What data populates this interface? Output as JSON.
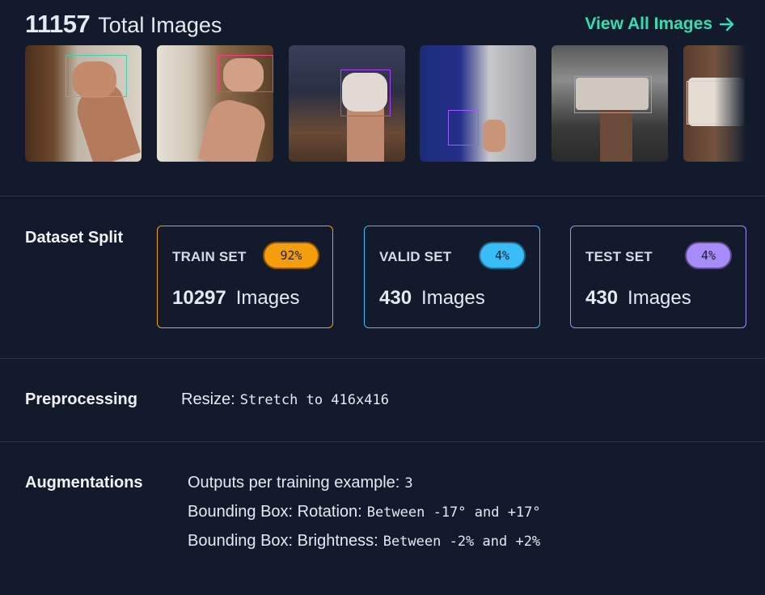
{
  "header": {
    "total_count": "11157",
    "total_label": "Total Images",
    "view_all_label": "View All Images"
  },
  "thumbnails": [
    {
      "icon": "hand-photo",
      "bbox_color": "#3fd0a8"
    },
    {
      "icon": "hand-photo",
      "bbox_color": "#ff3b7a"
    },
    {
      "icon": "hand-photo",
      "bbox_color": "#b23cff"
    },
    {
      "icon": "hand-photo",
      "bbox_color": "#9b5cff"
    },
    {
      "icon": "hand-photo",
      "bbox_color": "#9aa0aa"
    },
    {
      "icon": "hand-photo",
      "bbox_color": "#d0d0d0"
    }
  ],
  "dataset_split": {
    "label": "Dataset Split",
    "cards": [
      {
        "name": "TRAIN SET",
        "percent": "92%",
        "count": "10297",
        "unit": "Images",
        "color": "#f59e0b"
      },
      {
        "name": "VALID SET",
        "percent": "4%",
        "count": "430",
        "unit": "Images",
        "color": "#38bdf8"
      },
      {
        "name": "TEST SET",
        "percent": "4%",
        "count": "430",
        "unit": "Images",
        "color": "#a78bfa"
      }
    ]
  },
  "preprocessing": {
    "label": "Preprocessing",
    "key": "Resize:",
    "value": "Stretch to 416x416"
  },
  "augmentations": {
    "label": "Augmentations",
    "items": [
      {
        "key": "Outputs per training example:",
        "value": "3"
      },
      {
        "key": "Bounding Box: Rotation:",
        "value": "Between -17° and +17°"
      },
      {
        "key": "Bounding Box: Brightness:",
        "value": "Between -2% and +2%"
      }
    ]
  }
}
